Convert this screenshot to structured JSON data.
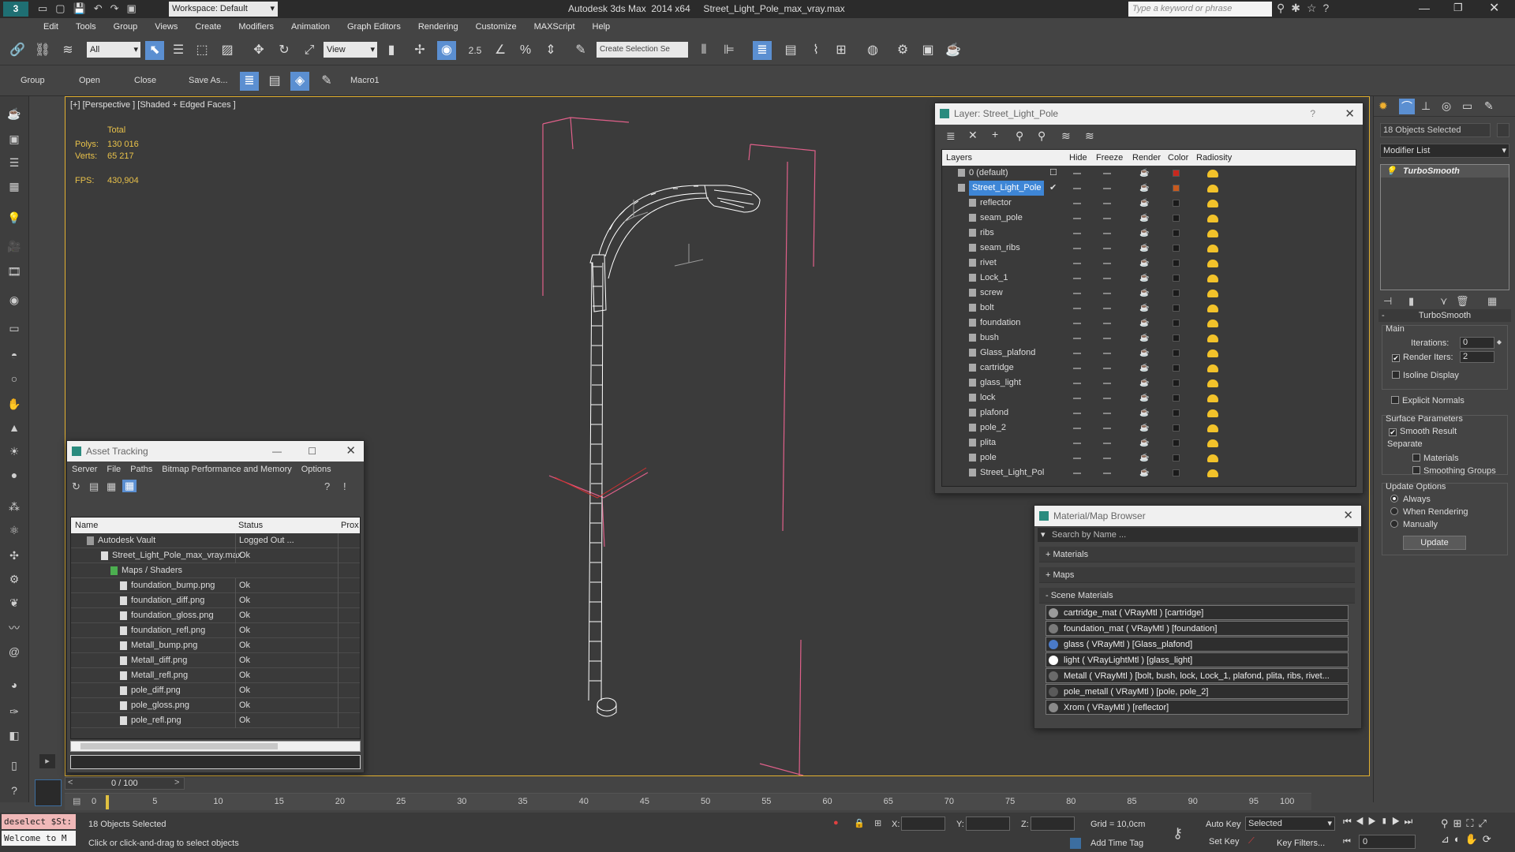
{
  "app": {
    "title": "Autodesk 3ds Max  2014 x64     Street_Light_Pole_max_vray.max",
    "workspace": "Workspace: Default",
    "search_placeholder": "Type a keyword or phrase"
  },
  "menu": [
    "Edit",
    "Tools",
    "Group",
    "Views",
    "Create",
    "Modifiers",
    "Animation",
    "Graph Editors",
    "Rendering",
    "Customize",
    "MAXScript",
    "Help"
  ],
  "toolbar": {
    "filter": "All",
    "ref_coord": "View",
    "selection_set": "Create Selection Se",
    "snap_value": "2.5"
  },
  "ribbon": {
    "group": "Group",
    "open": "Open",
    "close": "Close",
    "save_as": "Save As...",
    "macro": "Macro1"
  },
  "viewport": {
    "label": "[+] [Perspective ] [Shaded + Edged Faces ]",
    "total_label": "Total",
    "polys_label": "Polys:",
    "polys": "130 016",
    "verts_label": "Verts:",
    "verts": "65 217",
    "fps_label": "FPS:",
    "fps": "430,904"
  },
  "layer_dialog": {
    "title": "Layer: Street_Light_Pole",
    "help": "?",
    "columns": [
      "Layers",
      "Hide",
      "Freeze",
      "Render",
      "Color",
      "Radiosity"
    ],
    "rows": [
      {
        "name": "0 (default)",
        "color": "#c8281e",
        "level": 0
      },
      {
        "name": "Street_Light_Pole",
        "color": "#c85a1e",
        "level": 0,
        "selected": true
      },
      {
        "name": "reflector",
        "level": 1
      },
      {
        "name": "seam_pole",
        "level": 1
      },
      {
        "name": "ribs",
        "level": 1
      },
      {
        "name": "seam_ribs",
        "level": 1
      },
      {
        "name": "rivet",
        "level": 1
      },
      {
        "name": "Lock_1",
        "level": 1
      },
      {
        "name": "screw",
        "level": 1
      },
      {
        "name": "bolt",
        "level": 1
      },
      {
        "name": "foundation",
        "level": 1
      },
      {
        "name": "bush",
        "level": 1
      },
      {
        "name": "Glass_plafond",
        "level": 1
      },
      {
        "name": "cartridge",
        "level": 1
      },
      {
        "name": "glass_light",
        "level": 1
      },
      {
        "name": "lock",
        "level": 1
      },
      {
        "name": "plafond",
        "level": 1
      },
      {
        "name": "pole_2",
        "level": 1
      },
      {
        "name": "plita",
        "level": 1
      },
      {
        "name": "pole",
        "level": 1
      },
      {
        "name": "Street_Light_Pol",
        "level": 1
      }
    ]
  },
  "asset_tracking": {
    "title": "Asset Tracking",
    "menu": [
      "Server",
      "File",
      "Paths",
      "Bitmap Performance and Memory",
      "Options"
    ],
    "columns": [
      "Name",
      "Status",
      "Prox"
    ],
    "rows": [
      {
        "name": "Autodesk Vault",
        "status": "Logged Out ...",
        "indent": 1
      },
      {
        "name": "Street_Light_Pole_max_vray.max",
        "status": "Ok",
        "indent": 2
      },
      {
        "name": "Maps / Shaders",
        "status": "",
        "indent": 3
      },
      {
        "name": "foundation_bump.png",
        "status": "Ok",
        "indent": 4
      },
      {
        "name": "foundation_diff.png",
        "status": "Ok",
        "indent": 4
      },
      {
        "name": "foundation_gloss.png",
        "status": "Ok",
        "indent": 4
      },
      {
        "name": "foundation_refl.png",
        "status": "Ok",
        "indent": 4
      },
      {
        "name": "Metall_bump.png",
        "status": "Ok",
        "indent": 4
      },
      {
        "name": "Metall_diff.png",
        "status": "Ok",
        "indent": 4
      },
      {
        "name": "Metall_refl.png",
        "status": "Ok",
        "indent": 4
      },
      {
        "name": "pole_diff.png",
        "status": "Ok",
        "indent": 4
      },
      {
        "name": "pole_gloss.png",
        "status": "Ok",
        "indent": 4
      },
      {
        "name": "pole_refl.png",
        "status": "Ok",
        "indent": 4
      }
    ]
  },
  "material_browser": {
    "title": "Material/Map Browser",
    "search_placeholder": "Search by Name ...",
    "sections": [
      "+ Materials",
      "+ Maps",
      "- Scene Materials"
    ],
    "materials": [
      "cartridge_mat  ( VRayMtl ) [cartridge]",
      "foundation_mat  ( VRayMtl ) [foundation]",
      "glass  ( VRayMtl ) [Glass_plafond]",
      "light  ( VRayLightMtl ) [glass_light]",
      "Metall  ( VRayMtl ) [bolt, bush, lock, Lock_1, plafond, plita, ribs, rivet...",
      "pole_metall  ( VRayMtl ) [pole, pole_2]",
      "Xrom  ( VRayMtl ) [reflector]"
    ]
  },
  "command_panel": {
    "selection": "18 Objects Selected",
    "modifier_list": "Modifier List",
    "stack_item": "TurboSmooth",
    "rollout": "TurboSmooth",
    "main": "Main",
    "iterations_label": "Iterations:",
    "iterations": "0",
    "render_iters_label": "Render Iters:",
    "render_iters": "2",
    "isoline": "Isoline Display",
    "explicit_normals": "Explicit Normals",
    "surface_params": "Surface Parameters",
    "smooth_result": "Smooth Result",
    "separate": "Separate",
    "materials": "Materials",
    "smoothing_groups": "Smoothing Groups",
    "update_options": "Update Options",
    "always": "Always",
    "when_rendering": "When Rendering",
    "manually": "Manually",
    "update_button": "Update"
  },
  "timeline": {
    "frame": "0 / 100",
    "ticks": [
      "0",
      "5",
      "10",
      "15",
      "20",
      "25",
      "30",
      "35",
      "40",
      "45",
      "50",
      "55",
      "60",
      "65",
      "70",
      "75",
      "80",
      "85",
      "90",
      "95",
      "100"
    ]
  },
  "status": {
    "maxscript_1": "deselect $St:",
    "maxscript_2": "Welcome to M",
    "selection": "18 Objects Selected",
    "prompt": "Click or click-and-drag to select objects",
    "x_label": "X:",
    "y_label": "Y:",
    "z_label": "Z:",
    "grid": "Grid = 10,0cm",
    "add_time_tag": "Add Time Tag",
    "auto_key": "Auto Key",
    "set_key": "Set Key",
    "selected": "Selected",
    "key_filters": "Key Filters...",
    "frame_field": "0"
  }
}
